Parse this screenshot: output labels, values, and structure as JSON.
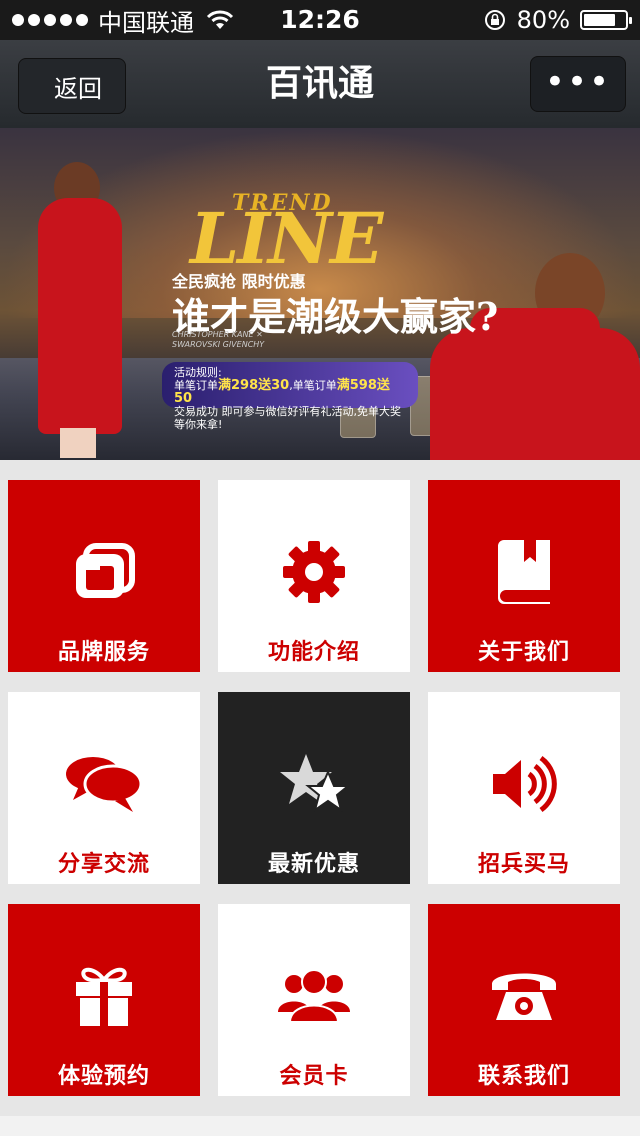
{
  "status_bar": {
    "carrier": "中国联通",
    "time": "12:26",
    "battery_percent": "80%",
    "battery_level": 0.8,
    "icons": [
      "signal-dots-icon",
      "wifi-icon",
      "rotation-lock-icon",
      "battery-icon"
    ]
  },
  "nav": {
    "back_label": "返回",
    "title": "百讯通",
    "more_label": "•••"
  },
  "banner": {
    "trend": "TREND",
    "line": "LINE",
    "subtitle": "全民疯抢  限时优惠",
    "headline": "谁才是潮级大赢家?",
    "fine_print": "CHRISTOPHER KANE ✕ SWAROVSKI GIVENCHY",
    "promo_line1_a": "活动规则:",
    "promo_line2_a": "单笔订单",
    "promo_line2_b": "满298送30",
    "promo_line2_c": ",单笔订单",
    "promo_line2_d": "满598送50",
    "promo_line3": "交易成功 即可参与微信好评有礼活动,免单大奖等你来拿!"
  },
  "tiles": [
    {
      "label": "品牌服务",
      "icon": "folder-icon",
      "style": "red"
    },
    {
      "label": "功能介绍",
      "icon": "gear-icon",
      "style": "white"
    },
    {
      "label": "关于我们",
      "icon": "book-icon",
      "style": "red"
    },
    {
      "label": "分享交流",
      "icon": "chat-bubbles-icon",
      "style": "white"
    },
    {
      "label": "最新优惠",
      "icon": "stars-icon",
      "style": "dark"
    },
    {
      "label": "招兵买马",
      "icon": "speaker-icon",
      "style": "white"
    },
    {
      "label": "体验预约",
      "icon": "gift-icon",
      "style": "red"
    },
    {
      "label": "会员卡",
      "icon": "members-icon",
      "style": "white"
    },
    {
      "label": "联系我们",
      "icon": "telephone-icon",
      "style": "red"
    }
  ],
  "colors": {
    "accent": "#cc0000",
    "dark_tile": "#222222",
    "background": "#e6e6e6"
  }
}
